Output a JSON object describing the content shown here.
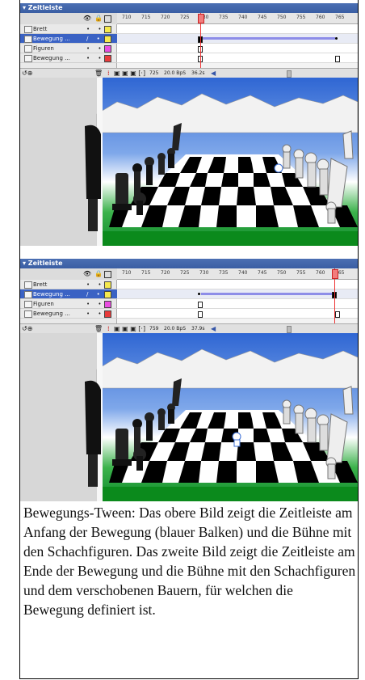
{
  "timeline_title": "▾ Zeitleiste",
  "shot1": {
    "ticks": [
      "710",
      "715",
      "720",
      "725",
      "730",
      "735",
      "740",
      "745",
      "750",
      "755",
      "760",
      "765"
    ],
    "layers": [
      {
        "name": "Brett",
        "color": "#f5e94d",
        "selected": false
      },
      {
        "name": "Bewegung ...",
        "color": "#f5e94d",
        "selected": true
      },
      {
        "name": "Figuren",
        "color": "#e84de0",
        "selected": false
      },
      {
        "name": "Bewegung ...",
        "color": "#e83b3b",
        "selected": false
      }
    ],
    "footer": {
      "frame": "725",
      "fps": "20.0 BpS",
      "time": "36.2s"
    }
  },
  "shot2": {
    "ticks": [
      "710",
      "715",
      "720",
      "725",
      "730",
      "735",
      "740",
      "745",
      "750",
      "755",
      "760",
      "765"
    ],
    "layers": [
      {
        "name": "Brett",
        "color": "#f5e94d",
        "selected": false
      },
      {
        "name": "Bewegung ...",
        "color": "#f5e94d",
        "selected": true
      },
      {
        "name": "Figuren",
        "color": "#e84de0",
        "selected": false
      },
      {
        "name": "Bewegung ...",
        "color": "#e83b3b",
        "selected": false
      }
    ],
    "footer": {
      "frame": "759",
      "fps": "20.0 BpS",
      "time": "37.9s"
    }
  },
  "caption": "Bewegungs-Tween: Das obere Bild zeigt die Zeitleiste am Anfang der Bewegung (blauer Balken) und die Bühne mit den Schachfiguren. Das zweite Bild zeigt die Zeitleiste am Ende der Bewegung und die Bühne mit den Schachfiguren und dem verschobenen Bauern, für welchen die Bewegung definiert ist."
}
